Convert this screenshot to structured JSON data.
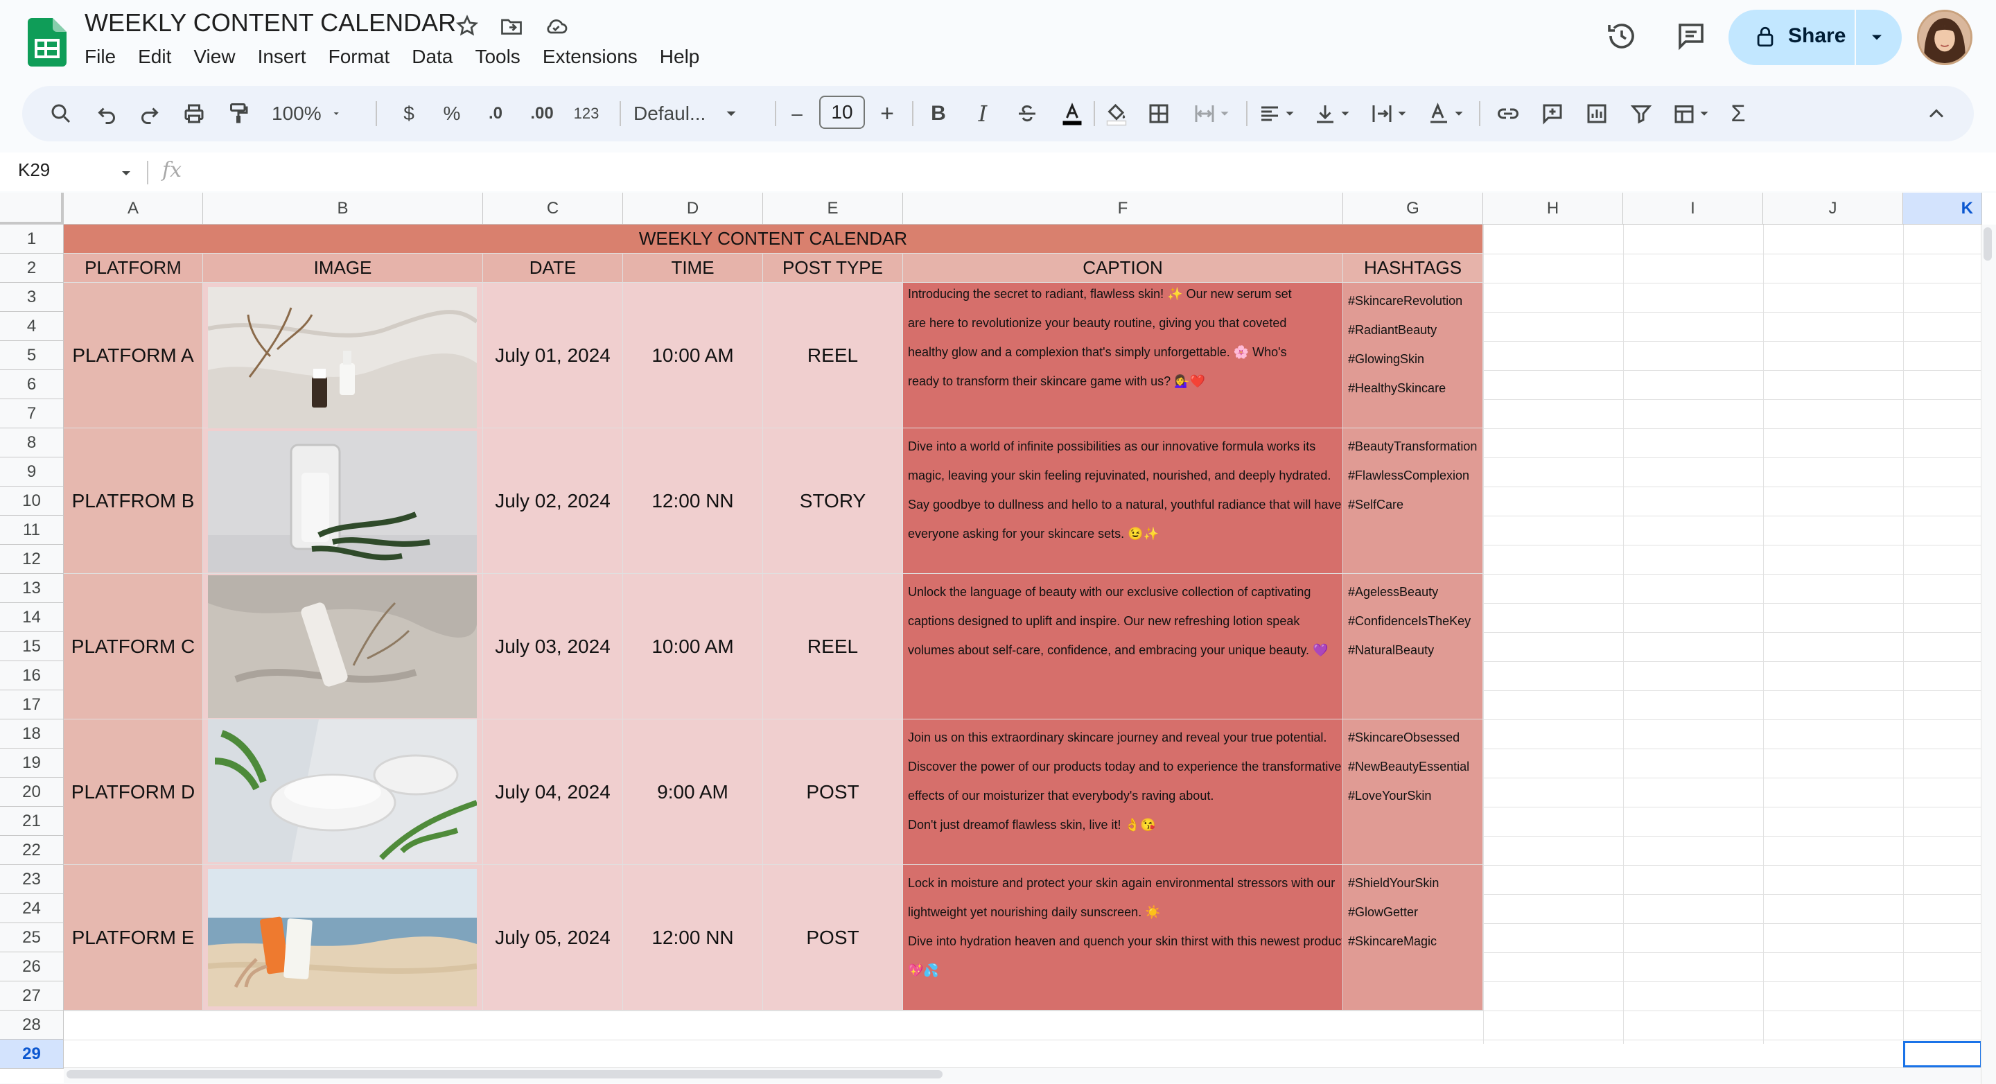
{
  "app": {
    "doc_title": "WEEKLY CONTENT CALENDAR",
    "menu": [
      "File",
      "Edit",
      "View",
      "Insert",
      "Format",
      "Data",
      "Tools",
      "Extensions",
      "Help"
    ],
    "share_label": "Share"
  },
  "toolbar": {
    "zoom": "100%",
    "currency": "$",
    "percent": "%",
    "dec_decrease": ".0",
    "dec_increase": ".00",
    "number_format": "123",
    "font": "Defaul...",
    "font_size": "10",
    "minus": "–",
    "plus": "+",
    "bold": "B",
    "italic": "I",
    "sum": "Σ"
  },
  "formula_bar": {
    "cell_ref": "K29",
    "fx": "fx"
  },
  "columns": [
    "A",
    "B",
    "C",
    "D",
    "E",
    "F",
    "G",
    "H",
    "I",
    "J",
    "K"
  ],
  "rows": [
    "1",
    "2",
    "3",
    "4",
    "5",
    "6",
    "7",
    "8",
    "9",
    "10",
    "11",
    "12",
    "13",
    "14",
    "15",
    "16",
    "17",
    "18",
    "19",
    "20",
    "21",
    "22",
    "23",
    "24",
    "25",
    "26",
    "27",
    "28",
    "29"
  ],
  "sheet": {
    "title": "WEEKLY CONTENT CALENDAR",
    "headers": [
      "PLATFORM",
      "IMAGE",
      "DATE",
      "TIME",
      "POST TYPE",
      "CAPTION",
      "HASHTAGS"
    ],
    "entries": [
      {
        "platform": "PLATFORM A",
        "date": "July 01, 2024",
        "time": "10:00 AM",
        "post_type": "REEL",
        "caption": [
          "Introducing the secret to radiant, flawless skin! ✨ Our new serum set",
          "are here to revolutionize your beauty routine, giving you that coveted",
          "healthy glow and a complexion that's simply unforgettable. 🌸 Who's",
          "ready to transform their skincare game with us? 💁‍♀️❤️"
        ],
        "hashtags": [
          "#SkincareRevolution",
          "#RadiantBeauty",
          "#GlowingSkin",
          "#HealthySkincare"
        ]
      },
      {
        "platform": "PLATFROM B",
        "date": "July 02, 2024",
        "time": "12:00 NN",
        "post_type": "STORY",
        "caption": [
          "Dive into a world of infinite possibilities as our innovative formula works its",
          "magic, leaving your skin feeling rejuvinated, nourished, and deeply hydrated.",
          "Say goodbye to dullness and hello to a natural, youthful radiance that will have",
          "everyone asking for your skincare sets. 😉✨"
        ],
        "hashtags": [
          "#BeautyTransformation",
          "#FlawlessComplexion",
          "#SelfCare"
        ]
      },
      {
        "platform": "PLATFORM C",
        "date": "July 03, 2024",
        "time": "10:00 AM",
        "post_type": "REEL",
        "caption": [
          "Unlock the language of beauty with our exclusive collection of captivating",
          "captions designed to uplift and inspire. Our new refreshing lotion speak",
          "volumes about self-care, confidence, and embracing your unique beauty. 💜"
        ],
        "hashtags": [
          "#AgelessBeauty",
          "#ConfidenceIsTheKey",
          "#NaturalBeauty"
        ]
      },
      {
        "platform": "PLATFORM D",
        "date": "July 04, 2024",
        "time": "9:00 AM",
        "post_type": "POST",
        "caption": [
          "Join us on this extraordinary skincare journey and reveal your true potential.",
          "Discover the power of our products today and to experience the transformative",
          "effects of our moisturizer that everybody's raving about.",
          "Don't just dreamof flawless skin, live it! 👌😘"
        ],
        "hashtags": [
          "#SkincareObsessed",
          "#NewBeautyEssential",
          "#LoveYourSkin"
        ]
      },
      {
        "platform": "PLATFORM E",
        "date": "July 05, 2024",
        "time": "12:00 NN",
        "post_type": "POST",
        "caption": [
          "Lock in moisture and protect your skin again environmental stressors with our",
          "lightweight yet nourishing daily sunscreen. ☀️",
          "Dive into hydration heaven and quench your skin thirst with this newest product",
          "💖💦"
        ],
        "hashtags": [
          "#ShieldYourSkin",
          "#GlowGetter",
          "#SkincareMagic"
        ]
      }
    ]
  },
  "colors": {
    "title_row": "#d9806e",
    "header_row": "#e6b3aa",
    "platform_col": "#e6b8af",
    "light_pink": "#f0cfcf",
    "caption_col": "#d66f6b",
    "hashtag_col": "#e09b94"
  }
}
